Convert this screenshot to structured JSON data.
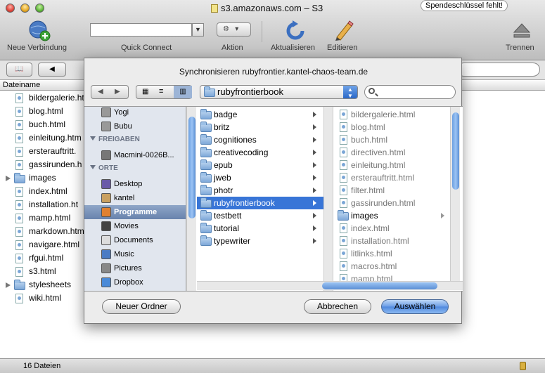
{
  "window": {
    "title": "s3.amazonaws.com – S3",
    "key_badge": "Spendeschlüssel fehlt!"
  },
  "toolbar": {
    "new_connection": "Neue Verbindung",
    "quick_connect": "Quick Connect",
    "action": "Aktion",
    "refresh": "Aktualisieren",
    "edit": "Editieren",
    "disconnect": "Trennen"
  },
  "filelist": {
    "column_name": "Dateiname",
    "items": [
      {
        "name": "bildergalerie.html",
        "type": "file"
      },
      {
        "name": "blog.html",
        "type": "file"
      },
      {
        "name": "buch.html",
        "type": "file"
      },
      {
        "name": "einleitung.htm",
        "type": "file"
      },
      {
        "name": "ersterauftritt.",
        "type": "file"
      },
      {
        "name": "gassirunden.h",
        "type": "file"
      },
      {
        "name": "images",
        "type": "folder"
      },
      {
        "name": "index.html",
        "type": "file"
      },
      {
        "name": "installation.ht",
        "type": "file"
      },
      {
        "name": "mamp.html",
        "type": "file"
      },
      {
        "name": "markdown.htm",
        "type": "file"
      },
      {
        "name": "navigare.html",
        "type": "file"
      },
      {
        "name": "rfgui.html",
        "type": "file"
      },
      {
        "name": "s3.html",
        "type": "file"
      },
      {
        "name": "stylesheets",
        "type": "folder"
      },
      {
        "name": "wiki.html",
        "type": "file"
      }
    ]
  },
  "status": {
    "count": "16 Dateien"
  },
  "sheet": {
    "title": "Synchronisieren rubyfrontier.kantel-chaos-team.de",
    "path": "rubyfrontierbook",
    "sidebar": {
      "devices": [
        "Yogi",
        "Bubu"
      ],
      "shared_header": "FREIGABEN",
      "shared": [
        "Macmini-0026B..."
      ],
      "places_header": "ORTE",
      "places": [
        "Desktop",
        "kantel",
        "Programme",
        "Movies",
        "Documents",
        "Music",
        "Pictures",
        "Dropbox"
      ],
      "selected": "Programme"
    },
    "column1": [
      "badge",
      "britz",
      "cognitiones",
      "creativecoding",
      "epub",
      "jweb",
      "photr",
      "rubyfrontierbook",
      "testbett",
      "tutorial",
      "typewriter"
    ],
    "column1_selected": "rubyfrontierbook",
    "column2": [
      {
        "name": "bildergalerie.html",
        "type": "file"
      },
      {
        "name": "blog.html",
        "type": "file"
      },
      {
        "name": "buch.html",
        "type": "file"
      },
      {
        "name": "directiven.html",
        "type": "file"
      },
      {
        "name": "einleitung.html",
        "type": "file"
      },
      {
        "name": "ersterauftritt.html",
        "type": "file"
      },
      {
        "name": "filter.html",
        "type": "file"
      },
      {
        "name": "gassirunden.html",
        "type": "file"
      },
      {
        "name": "images",
        "type": "folder"
      },
      {
        "name": "index.html",
        "type": "file"
      },
      {
        "name": "installation.html",
        "type": "file"
      },
      {
        "name": "litlinks.html",
        "type": "file"
      },
      {
        "name": "macros.html",
        "type": "file"
      },
      {
        "name": "mamp.html",
        "type": "file"
      }
    ],
    "buttons": {
      "new_folder": "Neuer Ordner",
      "cancel": "Abbrechen",
      "choose": "Auswählen"
    }
  }
}
